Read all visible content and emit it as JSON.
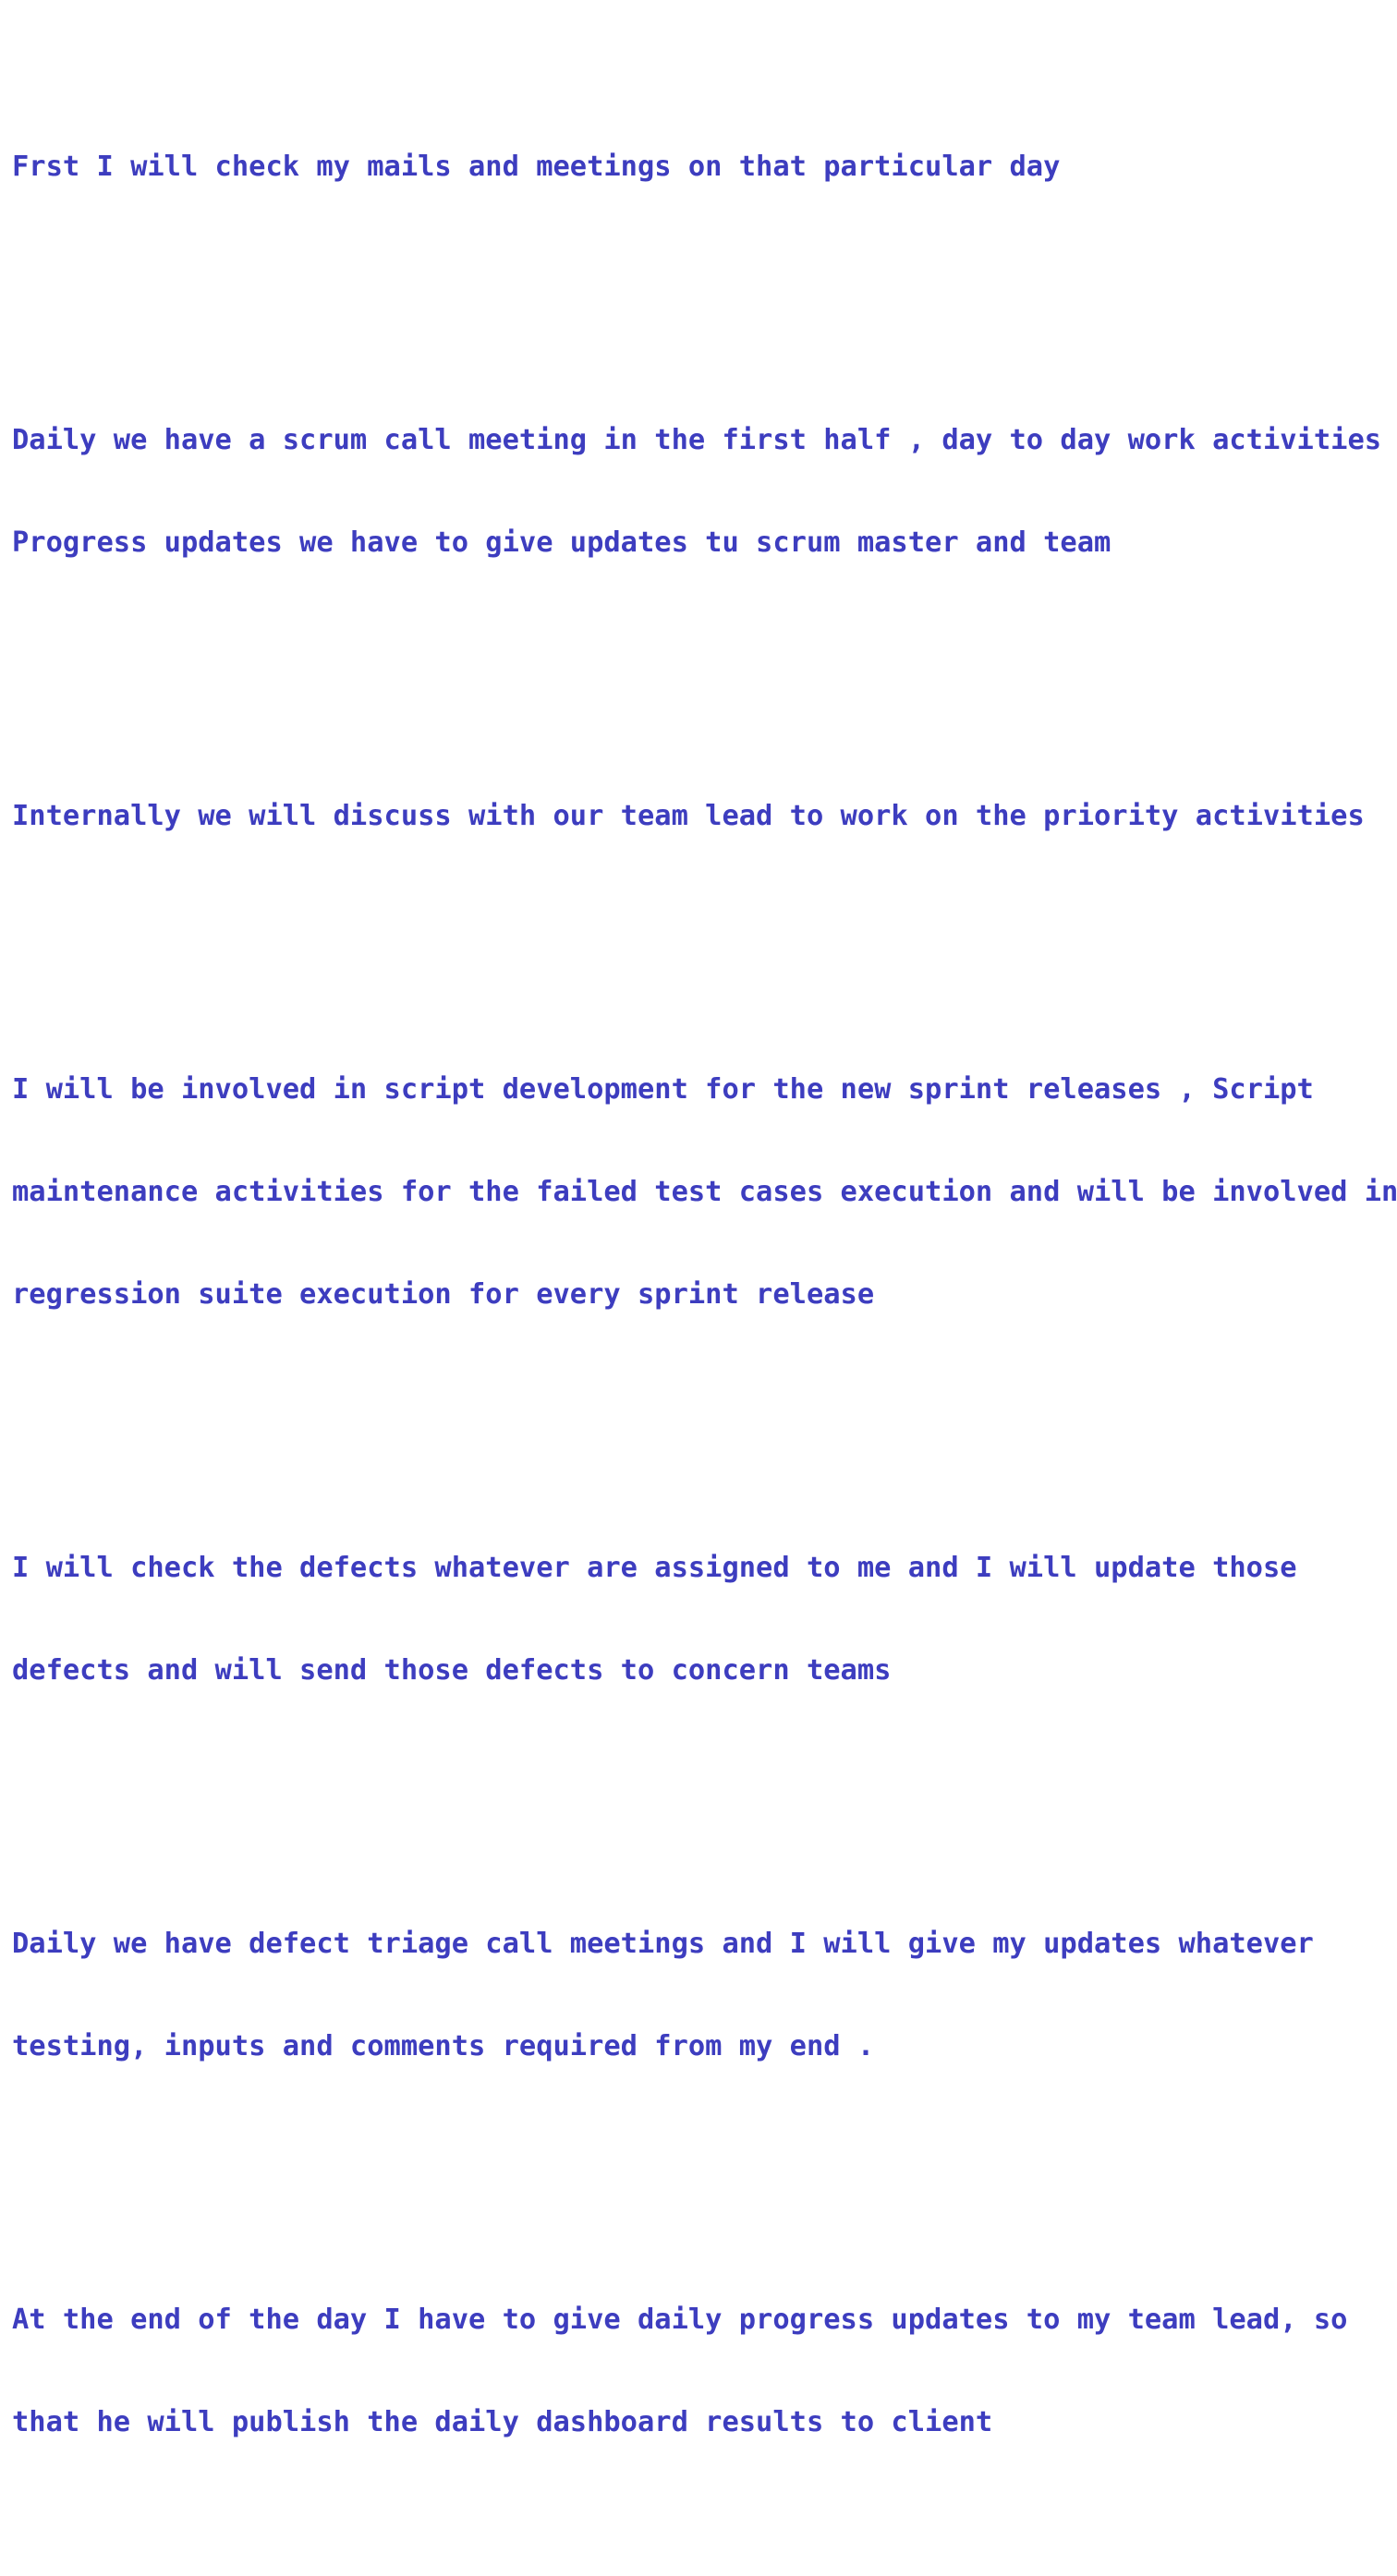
{
  "document": {
    "paragraphs": [
      {
        "lines": [
          "Frst I will check my mails and meetings on that particular day"
        ]
      },
      {
        "lines": [
          "Daily we have a scrum call meeting in the first half , day to day work activities &",
          "Progress updates we have to give updates tu scrum master and team"
        ]
      },
      {
        "lines": [
          "Internally we will discuss with our team lead to work on the priority activities"
        ]
      },
      {
        "lines": [
          "I will be involved in script development for the new sprint releases , Script",
          "maintenance activities for the failed test cases execution and will be involved in",
          "regression suite execution for every sprint release"
        ]
      },
      {
        "lines": [
          "I will check the defects whatever are assigned to me and I will update those",
          "defects and will send those defects to concern teams"
        ]
      },
      {
        "lines": [
          "Daily we have defect triage call meetings and I will give my updates whatever",
          "testing, inputs and comments required from my end ."
        ]
      },
      {
        "lines": [
          "At the end of the day I have to give daily progress updates to my team lead, so",
          "that he will publish the daily dashboard results to client"
        ]
      }
    ]
  },
  "colors": {
    "text": "#3d3dbf",
    "background": "#ffffff"
  }
}
